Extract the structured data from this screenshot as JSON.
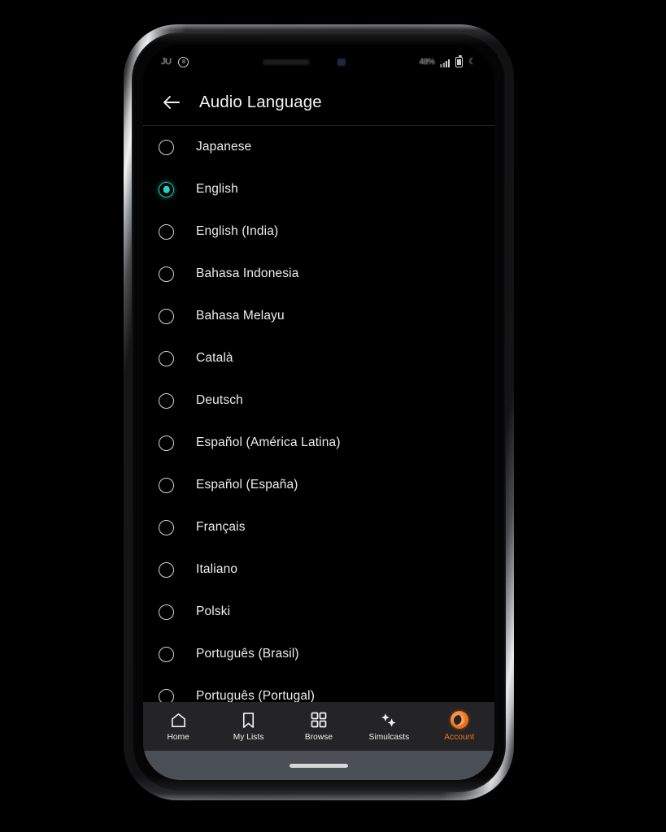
{
  "device": {
    "type": "smartphone-mockup"
  },
  "status_bar": {
    "left_glyph": "JU",
    "left_icon": "circled-8-icon",
    "battery_percent": "48%",
    "signal_icon": "signal-bars-icon",
    "battery_icon": "battery-icon",
    "dnd_icon": "crescent-moon-icon"
  },
  "app_bar": {
    "back_icon": "back-arrow-icon",
    "title": "Audio Language"
  },
  "languages": [
    {
      "label": "Japanese",
      "selected": false
    },
    {
      "label": "English",
      "selected": true
    },
    {
      "label": "English (India)",
      "selected": false
    },
    {
      "label": "Bahasa Indonesia",
      "selected": false
    },
    {
      "label": "Bahasa Melayu",
      "selected": false
    },
    {
      "label": "Català",
      "selected": false
    },
    {
      "label": "Deutsch",
      "selected": false
    },
    {
      "label": "Español (América Latina)",
      "selected": false
    },
    {
      "label": "Español (España)",
      "selected": false
    },
    {
      "label": "Français",
      "selected": false
    },
    {
      "label": "Italiano",
      "selected": false
    },
    {
      "label": "Polski",
      "selected": false
    },
    {
      "label": "Português (Brasil)",
      "selected": false
    },
    {
      "label": "Português (Portugal)",
      "selected": false
    }
  ],
  "bottom_nav": [
    {
      "label": "Home",
      "icon": "home-icon",
      "active": false
    },
    {
      "label": "My Lists",
      "icon": "bookmark-icon",
      "active": false
    },
    {
      "label": "Browse",
      "icon": "grid-icon",
      "active": false
    },
    {
      "label": "Simulcasts",
      "icon": "sparkles-icon",
      "active": false
    },
    {
      "label": "Account",
      "icon": "crunchyroll-logo-icon",
      "active": true
    }
  ],
  "colors": {
    "accent_selected": "#24d3c2",
    "brand_orange": "#f47521",
    "nav_background": "#242426",
    "screen_background": "#000000",
    "text_primary": "#ededed",
    "gesture_bar": "#4a4f55"
  }
}
